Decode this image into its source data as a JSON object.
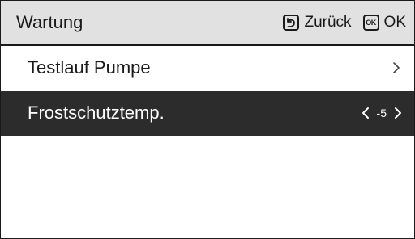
{
  "header": {
    "title": "Wartung",
    "back_label": "Zurück",
    "ok_icon_text": "OK",
    "ok_label": "OK"
  },
  "menu": {
    "items": [
      {
        "label": "Testlauf Pumpe",
        "icon": "chevron-right-icon"
      },
      {
        "label": "Frostschutztemp.",
        "value": "-5",
        "selected": true
      }
    ]
  },
  "colors": {
    "header_background": "#e1e1e1",
    "selected_background": "#2c2c2c",
    "selected_text": "#ffffff",
    "text": "#1a1a1a"
  }
}
